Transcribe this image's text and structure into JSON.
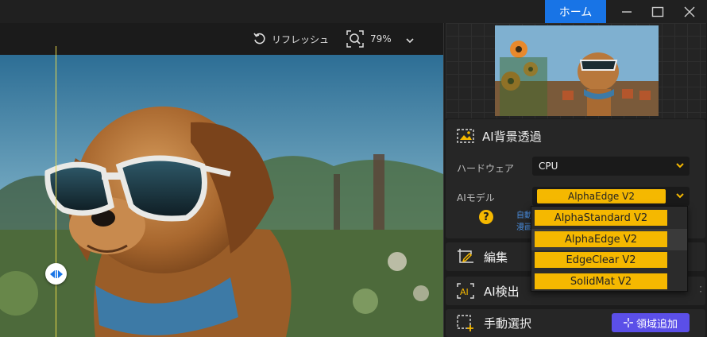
{
  "window": {
    "home_label": "ホーム",
    "minimize_icon": "minimize-icon",
    "maximize_icon": "maximize-icon",
    "close_icon": "close-icon",
    "accent_color": "#1874e6"
  },
  "toolbar": {
    "refresh_label": "リフレッシュ",
    "zoom_value": "79%"
  },
  "panel": {
    "ai_section": {
      "title": "AI背景透過",
      "hardware_label": "ハードウェア",
      "hardware_value": "CPU",
      "model_label": "AIモデル",
      "model_value": "AlphaEdge  V2",
      "hint_line1": "自動",
      "hint_line2": "漫画"
    },
    "edit_label": "編集",
    "detect_label": "AI検出",
    "manual_label": "手動選択",
    "add_region_label": "領域追加"
  },
  "model_dropdown": {
    "options": [
      "AlphaStandard  V2",
      "AlphaEdge  V2",
      "EdgeClear  V2",
      "SolidMat  V2"
    ],
    "highlighted_index": 1,
    "option_color": "#f5b800"
  }
}
